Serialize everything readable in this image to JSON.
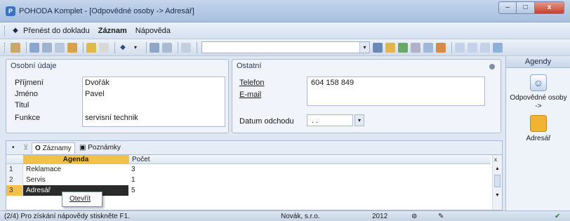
{
  "window": {
    "title": "POHODA Komplet - [Odpovědné osoby -> Adresář]",
    "minimize": "–",
    "maximize": "□",
    "close": "x"
  },
  "menu": {
    "items": [
      {
        "label": "Přenést do dokladu",
        "bold": false
      },
      {
        "label": "Záznam",
        "bold": true
      },
      {
        "label": "Nápověda",
        "bold": false
      }
    ]
  },
  "toolbar": {
    "icons": [
      "book-icon",
      "people-icon",
      "print-icon",
      "preview-icon",
      "filter-icon",
      "new-icon",
      "edit-icon",
      "nav-icon",
      "save-icon",
      "copy-icon",
      "paste-icon"
    ],
    "combo_value": "",
    "combo_arrow": "▾"
  },
  "personal": {
    "title": "Osobní údaje",
    "fields": [
      {
        "label": "Příjmení",
        "value": "Dvořák"
      },
      {
        "label": "Jméno",
        "value": "Pavel"
      },
      {
        "label": "Titul",
        "value": ""
      },
      {
        "label": "Funkce",
        "value": "servisní technik"
      }
    ]
  },
  "other": {
    "title": "Ostatní",
    "phone_label": "Telefon",
    "phone_value": "604 158 849",
    "email_label": "E-mail",
    "email_value": "",
    "leave_label": "Datum odchodu",
    "leave_value": ". .",
    "leave_arrow": "▾"
  },
  "tabs": {
    "records": "Záznamy",
    "notes": "Poznámky"
  },
  "grid": {
    "headers": [
      "Agenda",
      "Počet"
    ],
    "rows": [
      {
        "num": "1",
        "agenda": "Reklamace",
        "count": "3"
      },
      {
        "num": "2",
        "agenda": "Servis",
        "count": "1"
      },
      {
        "num": "3",
        "agenda": "Adresář",
        "count": "5"
      }
    ]
  },
  "context_menu": {
    "open": "Otevřít"
  },
  "sidebar": {
    "title": "Agendy",
    "items": [
      {
        "label": "Odpovědné osoby",
        "sub": "->"
      },
      {
        "label": "Adresář",
        "sub": ""
      }
    ]
  },
  "status": {
    "hint": "(2/4) Pro získání nápovědy stiskněte F1.",
    "company": "Novák, s.r.o.",
    "year": "2012"
  },
  "colors": {
    "accent": "#3a73c4",
    "grid_header": "#f2c14a",
    "selected_row": "#2a2a2a"
  }
}
